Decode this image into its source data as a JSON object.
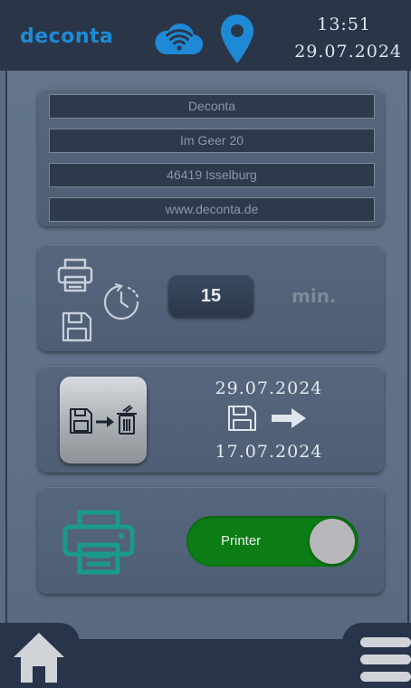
{
  "header": {
    "brand": "deconta",
    "time": "13:51",
    "date": "29.07.2024",
    "icons": [
      "cloud-wifi-icon",
      "location-pin-icon"
    ],
    "accent_color": "#1e8ad6"
  },
  "address": {
    "lines": [
      "Deconta",
      "Im Geer 20",
      "46419 Isselburg",
      "www.deconta.de"
    ]
  },
  "save_interval": {
    "value": "15",
    "unit": "min.",
    "icons": [
      "printer-icon",
      "save-icon",
      "timer-icon"
    ]
  },
  "data_cleanup": {
    "from_date": "29.07.2024",
    "to_date": "17.07.2024",
    "icons": [
      "save-to-trash-icon",
      "save-icon",
      "arrow-right-icon"
    ]
  },
  "printer": {
    "toggle_label": "Printer",
    "toggle_on": true,
    "toggle_color": "#0c7d14",
    "icon_color": "#1a9a8a"
  },
  "bottom_nav": {
    "icons": [
      "home-icon",
      "menu-icon"
    ]
  }
}
